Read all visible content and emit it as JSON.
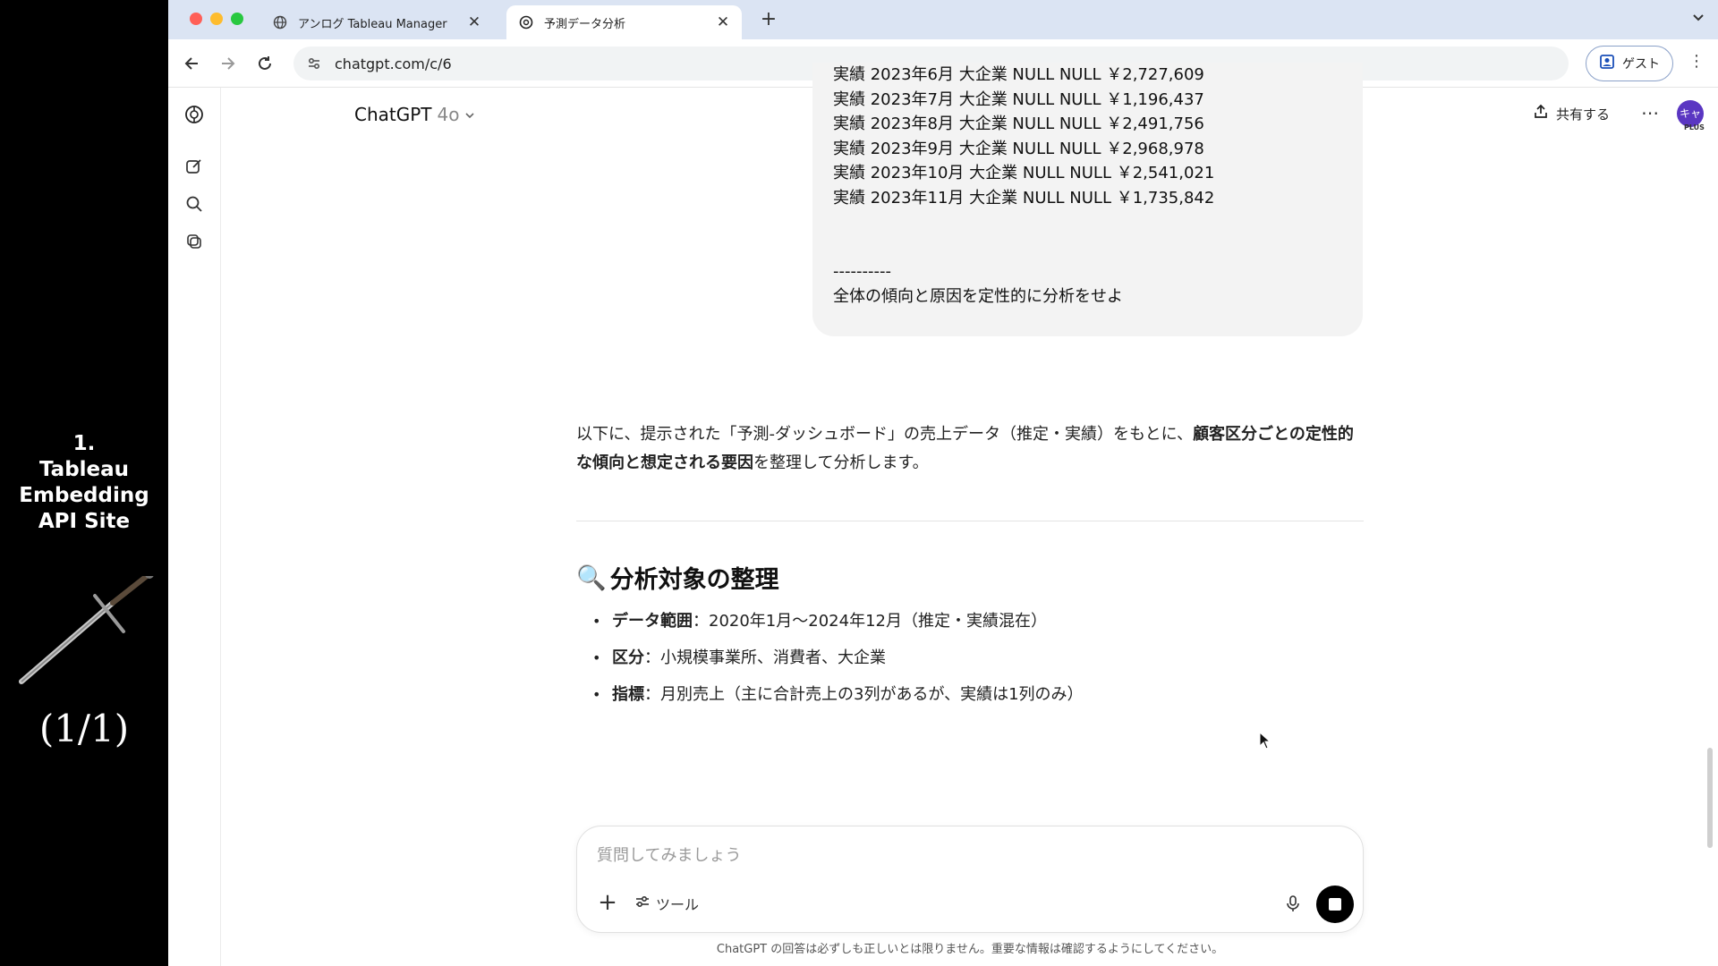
{
  "overlay": {
    "title_lines": [
      "1.",
      "Tableau",
      "Embedding",
      "API Site"
    ],
    "counter": "(1/1)"
  },
  "browser": {
    "tabs": [
      {
        "title": "アンログ Tableau Manager",
        "active": false
      },
      {
        "title": "予測データ分析",
        "active": true
      }
    ],
    "url": "chatgpt.com/c/6",
    "profile_label": "ゲスト"
  },
  "app": {
    "model_name": "ChatGPT",
    "model_version": "4o",
    "share_label": "共有する",
    "avatar_text": "キャ",
    "plan_badge": "PLUS"
  },
  "user_message": {
    "lines": [
      "実績  2023年6月  大企業  NULL  NULL  ￥2,727,609",
      "実績  2023年7月  大企業  NULL  NULL  ￥1,196,437",
      "実績  2023年8月  大企業  NULL  NULL  ￥2,491,756",
      "実績  2023年9月  大企業  NULL  NULL  ￥2,968,978",
      "実績  2023年10月  大企業  NULL  NULL  ￥2,541,021",
      "実績  2023年11月  大企業  NULL  NULL  ￥1,735,842",
      "",
      "",
      "----------",
      "全体の傾向と原因を定性的に分析をせよ"
    ]
  },
  "answer": {
    "intro_pre": "以下に、提示された「予測-ダッシュボード」の売上データ（推定・実績）をもとに、",
    "intro_bold": "顧客区分ごとの定性的な傾向と想定される要因",
    "intro_post": "を整理して分析します。",
    "section_icon": "🔍",
    "section_title": "分析対象の整理",
    "bullets": [
      {
        "label": "データ範囲",
        "text": "：2020年1月〜2024年12月（推定・実績混在）"
      },
      {
        "label": "区分",
        "text": "：小規模事業所、消費者、大企業"
      },
      {
        "label": "指標",
        "text": "：月別売上（主に合計売上の3列があるが、実績は1列のみ）"
      }
    ]
  },
  "composer": {
    "placeholder": "質問してみましょう",
    "tools_label": "ツール"
  },
  "disclaimer": "ChatGPT の回答は必ずしも正しいとは限りません。重要な情報は確認するようにしてください。"
}
